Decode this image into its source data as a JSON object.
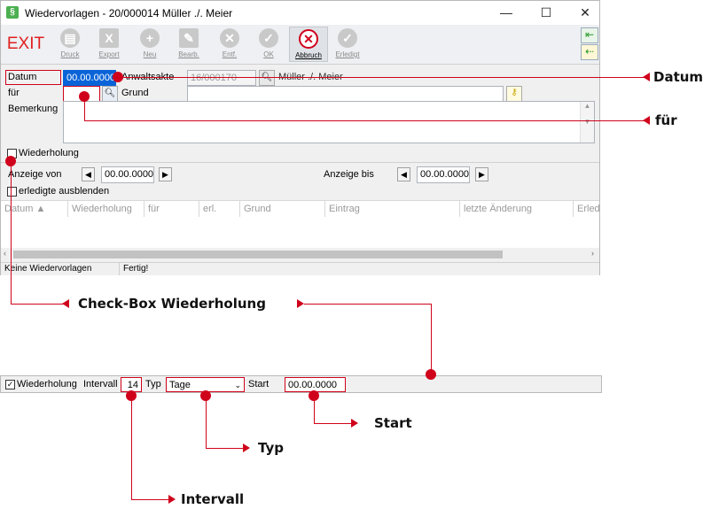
{
  "window": {
    "app_icon": "§",
    "title": "Wiedervorlagen - 20/000014 Müller ./. Meier",
    "controls": {
      "minimize": "—",
      "maximize": "☐",
      "close": "✕"
    }
  },
  "toolbar": {
    "exit": "EXIT",
    "buttons": [
      {
        "label": "Druck",
        "icon": "printer-icon"
      },
      {
        "label": "Export",
        "icon": "excel-icon"
      },
      {
        "label": "Neu",
        "icon": "plus-icon"
      },
      {
        "label": "Bearb.",
        "icon": "pencil-icon"
      },
      {
        "label": "Entf.",
        "icon": "x-icon"
      },
      {
        "label": "OK",
        "icon": "check-icon"
      },
      {
        "label": "Abbruch",
        "icon": "cancel-icon"
      },
      {
        "label": "Erledigt",
        "icon": "check-icon"
      }
    ],
    "side_icons": [
      "arrow-left-icon",
      "arrow-left-yellow-icon"
    ]
  },
  "form": {
    "datum_label": "Datum",
    "datum_value": "00.00.0000",
    "anwaltsakte_label": "Anwaltsakte",
    "anwaltsakte_value": "16/000170",
    "anwaltsakte_name": "Müller ./. Meier",
    "fuer_label": "für",
    "fuer_value": "",
    "grund_label": "Grund",
    "grund_value": "",
    "bemerkung_label": "Bemerkung",
    "wiederholung_label": "Wiederholung",
    "anzeige_von_label": "Anzeige von",
    "anzeige_von_value": "00.00.0000",
    "anzeige_bis_label": "Anzeige bis",
    "anzeige_bis_value": "00.00.0000",
    "erledigte_label": "erledigte ausblenden"
  },
  "table": {
    "columns": [
      "Datum ▲",
      "Wiederholung",
      "für",
      "erl.",
      "Grund",
      "Eintrag",
      "letzte Änderung",
      "Erled"
    ]
  },
  "status": {
    "left": "Keine Wiedervorlagen",
    "right": "Fertig!"
  },
  "detail_bar": {
    "wiederholung_label": "Wiederholung",
    "intervall_label": "Intervall",
    "intervall_value": "14",
    "typ_label": "Typ",
    "typ_value": "Tage",
    "start_label": "Start",
    "start_value": "00.00.0000"
  },
  "callouts": {
    "datum": "Datum",
    "fuer": "für",
    "checkbox": "Check-Box Wiederholung",
    "start": "Start",
    "typ": "Typ",
    "intervall": "Intervall"
  },
  "colors": {
    "accent_red": "#d0021b",
    "exit_red": "#e02020",
    "selection_blue": "#0a64d8"
  }
}
